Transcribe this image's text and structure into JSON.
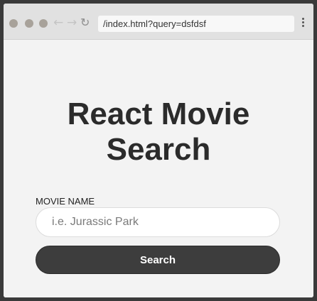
{
  "browser": {
    "address": "/index.html?query=dsfdsf",
    "back_icon": "back-arrow-icon",
    "forward_icon": "forward-arrow-icon",
    "reload_icon": "reload-icon",
    "menu_icon": "vertical-ellipsis-icon",
    "traffic_light_color": "#a8a29a"
  },
  "page": {
    "title_line1": "React Movie",
    "title_line2": "Search",
    "field_label": "MOVIE NAME",
    "search_placeholder": "i.e. Jurassic Park",
    "search_value": "",
    "search_button": "Search"
  },
  "colors": {
    "background": "#f3f3f3",
    "button": "#3d3d3d",
    "title": "#2b2b2b"
  }
}
